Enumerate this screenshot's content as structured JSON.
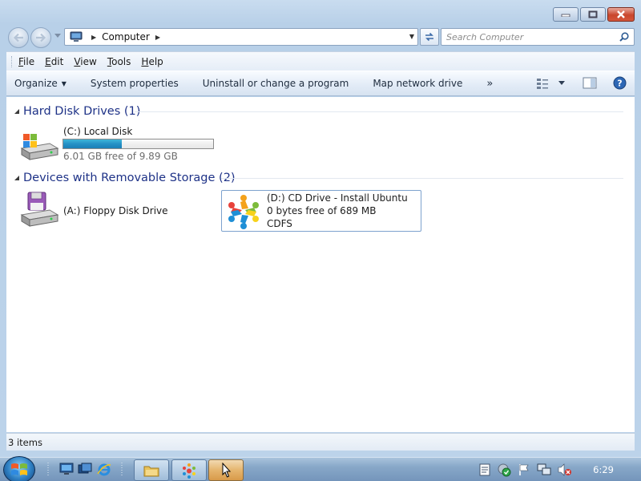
{
  "address": {
    "crumb": "Computer"
  },
  "search": {
    "placeholder": "Search Computer"
  },
  "menu": {
    "file": "File",
    "edit": "Edit",
    "view": "View",
    "tools": "Tools",
    "help": "Help"
  },
  "commands": {
    "organize": "Organize",
    "system_properties": "System properties",
    "uninstall": "Uninstall or change a program",
    "map_drive": "Map network drive",
    "more": "»"
  },
  "groups": {
    "hdd": {
      "title": "Hard Disk Drives (1)",
      "drives": [
        {
          "name": "(C:) Local Disk",
          "free_text": "6.01 GB free of 9.89 GB",
          "used_fraction": 0.39
        }
      ]
    },
    "removable": {
      "title": "Devices with Removable Storage (2)",
      "drives": [
        {
          "name": "(A:) Floppy Disk Drive"
        },
        {
          "name": "(D:) CD Drive - Install Ubuntu",
          "free_text": "0 bytes free of 689 MB",
          "filesystem": "CDFS"
        }
      ]
    }
  },
  "status": {
    "items": "3 items"
  },
  "taskbar": {
    "clock": "6:29"
  },
  "colors": {
    "group_title": "#1e3287",
    "bar_fill": "#2691c6",
    "selected_border": "#7da2ce"
  }
}
